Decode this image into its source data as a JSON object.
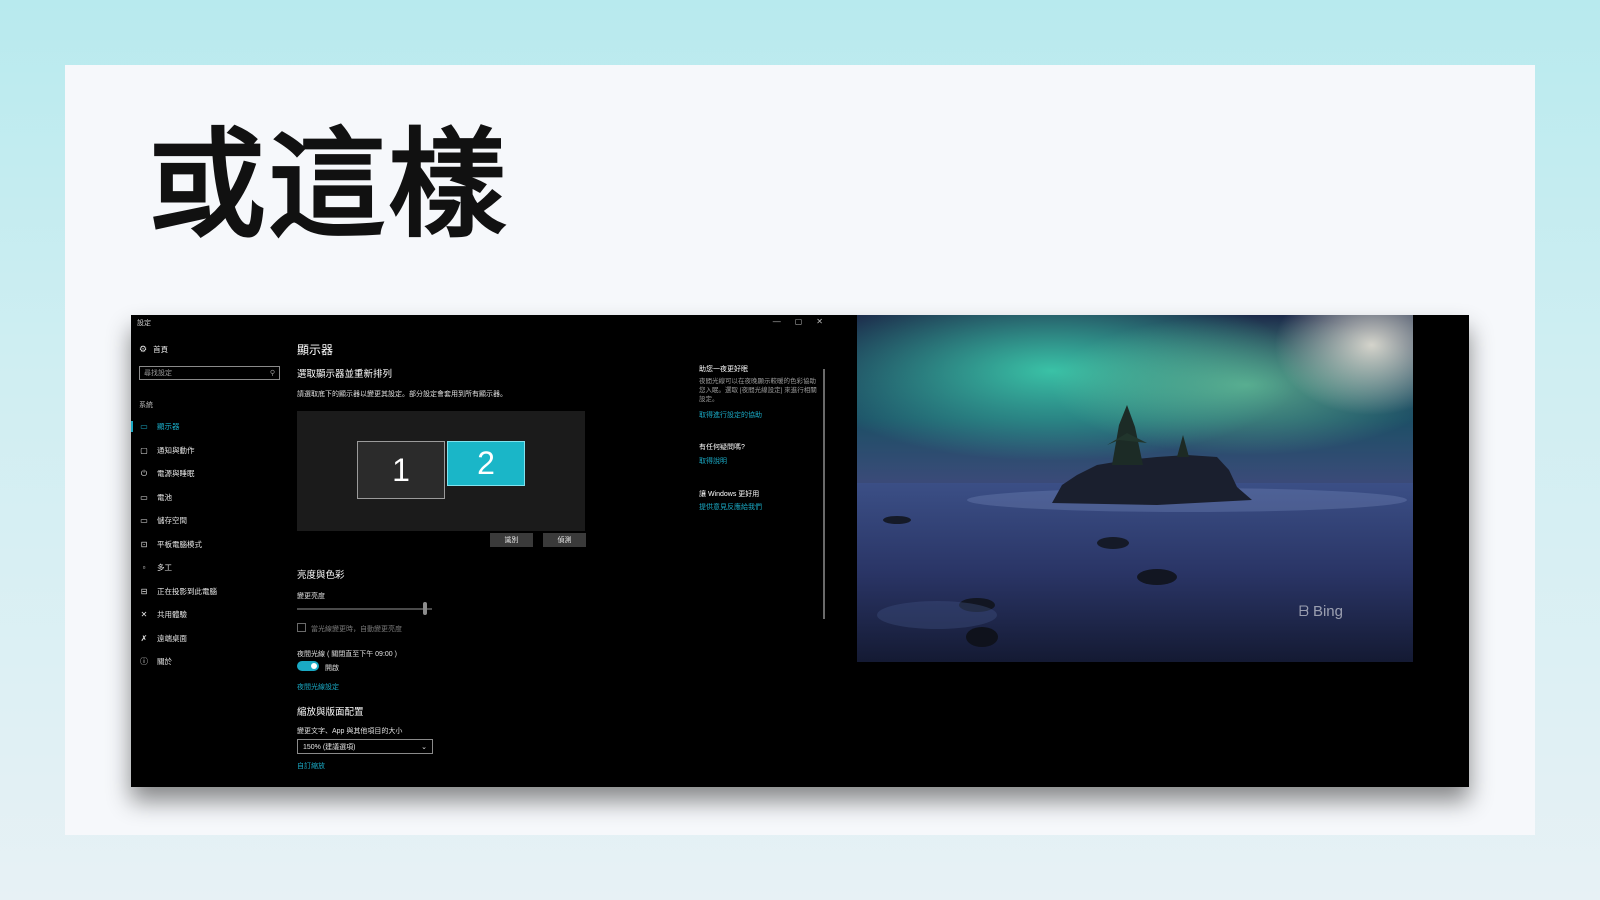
{
  "slide": {
    "title": "或這樣"
  },
  "window": {
    "title": "設定",
    "controls": {
      "minimize": "—",
      "maximize": "▢",
      "close": "✕"
    }
  },
  "sidebar": {
    "home": "首頁",
    "search_placeholder": "尋找設定",
    "section": "系統",
    "items": [
      {
        "label": "顯示器",
        "icon": "monitor-icon",
        "glyph": "▭",
        "active": true
      },
      {
        "label": "通知與動作",
        "icon": "notification-icon",
        "glyph": "▢",
        "active": false
      },
      {
        "label": "電源與睡眠",
        "icon": "power-icon",
        "glyph": "⏻",
        "active": false
      },
      {
        "label": "電池",
        "icon": "battery-icon",
        "glyph": "▭",
        "active": false
      },
      {
        "label": "儲存空間",
        "icon": "storage-icon",
        "glyph": "▭",
        "active": false
      },
      {
        "label": "平板電腦模式",
        "icon": "tablet-icon",
        "glyph": "⊡",
        "active": false
      },
      {
        "label": "多工",
        "icon": "multitask-icon",
        "glyph": "▫",
        "active": false
      },
      {
        "label": "正在投影到此電腦",
        "icon": "project-icon",
        "glyph": "⊟",
        "active": false
      },
      {
        "label": "共用體驗",
        "icon": "shared-experience-icon",
        "glyph": "✕",
        "active": false
      },
      {
        "label": "遠端桌面",
        "icon": "remote-desktop-icon",
        "glyph": "✗",
        "active": false
      },
      {
        "label": "關於",
        "icon": "info-icon",
        "glyph": "ⓘ",
        "active": false
      }
    ]
  },
  "main": {
    "title": "顯示器",
    "arrange_heading": "選取顯示器並重新排列",
    "arrange_desc": "請選取底下的顯示器以變更其設定。部分設定會套用到所有顯示器。",
    "monitors": [
      "1",
      "2"
    ],
    "identify_button": "識別",
    "detect_button": "偵測",
    "brightness_heading": "亮度與色彩",
    "brightness_label": "變更亮度",
    "brightness_level_percent": 95,
    "auto_brightness_label": "當光線變更時，自動變更亮度",
    "night_light_label": "夜間光線 ( 關閉直至下午 09:00 )",
    "night_light_toggle": "開啟",
    "night_light_link": "夜間光線設定",
    "scale_heading": "縮放與版面配置",
    "scale_label": "變更文字、App 與其他項目的大小",
    "scale_value": "150% (建議選項)",
    "custom_scale_link": "自訂縮放"
  },
  "help_panel": {
    "tip_heading": "助您一夜更好眠",
    "tip_body": "夜間光線可以在夜晚顯示較暖的色彩協助您入眠。選取 [夜間光線設定] 來進行相關設定。",
    "tip_link": "取得進行設定的協助",
    "question_heading": "有任何疑問嗎?",
    "question_link": "取得說明",
    "feedback_heading": "讓 Windows 更好用",
    "feedback_link": "提供意見反應給我們"
  },
  "photo": {
    "watermark": "Bing"
  }
}
